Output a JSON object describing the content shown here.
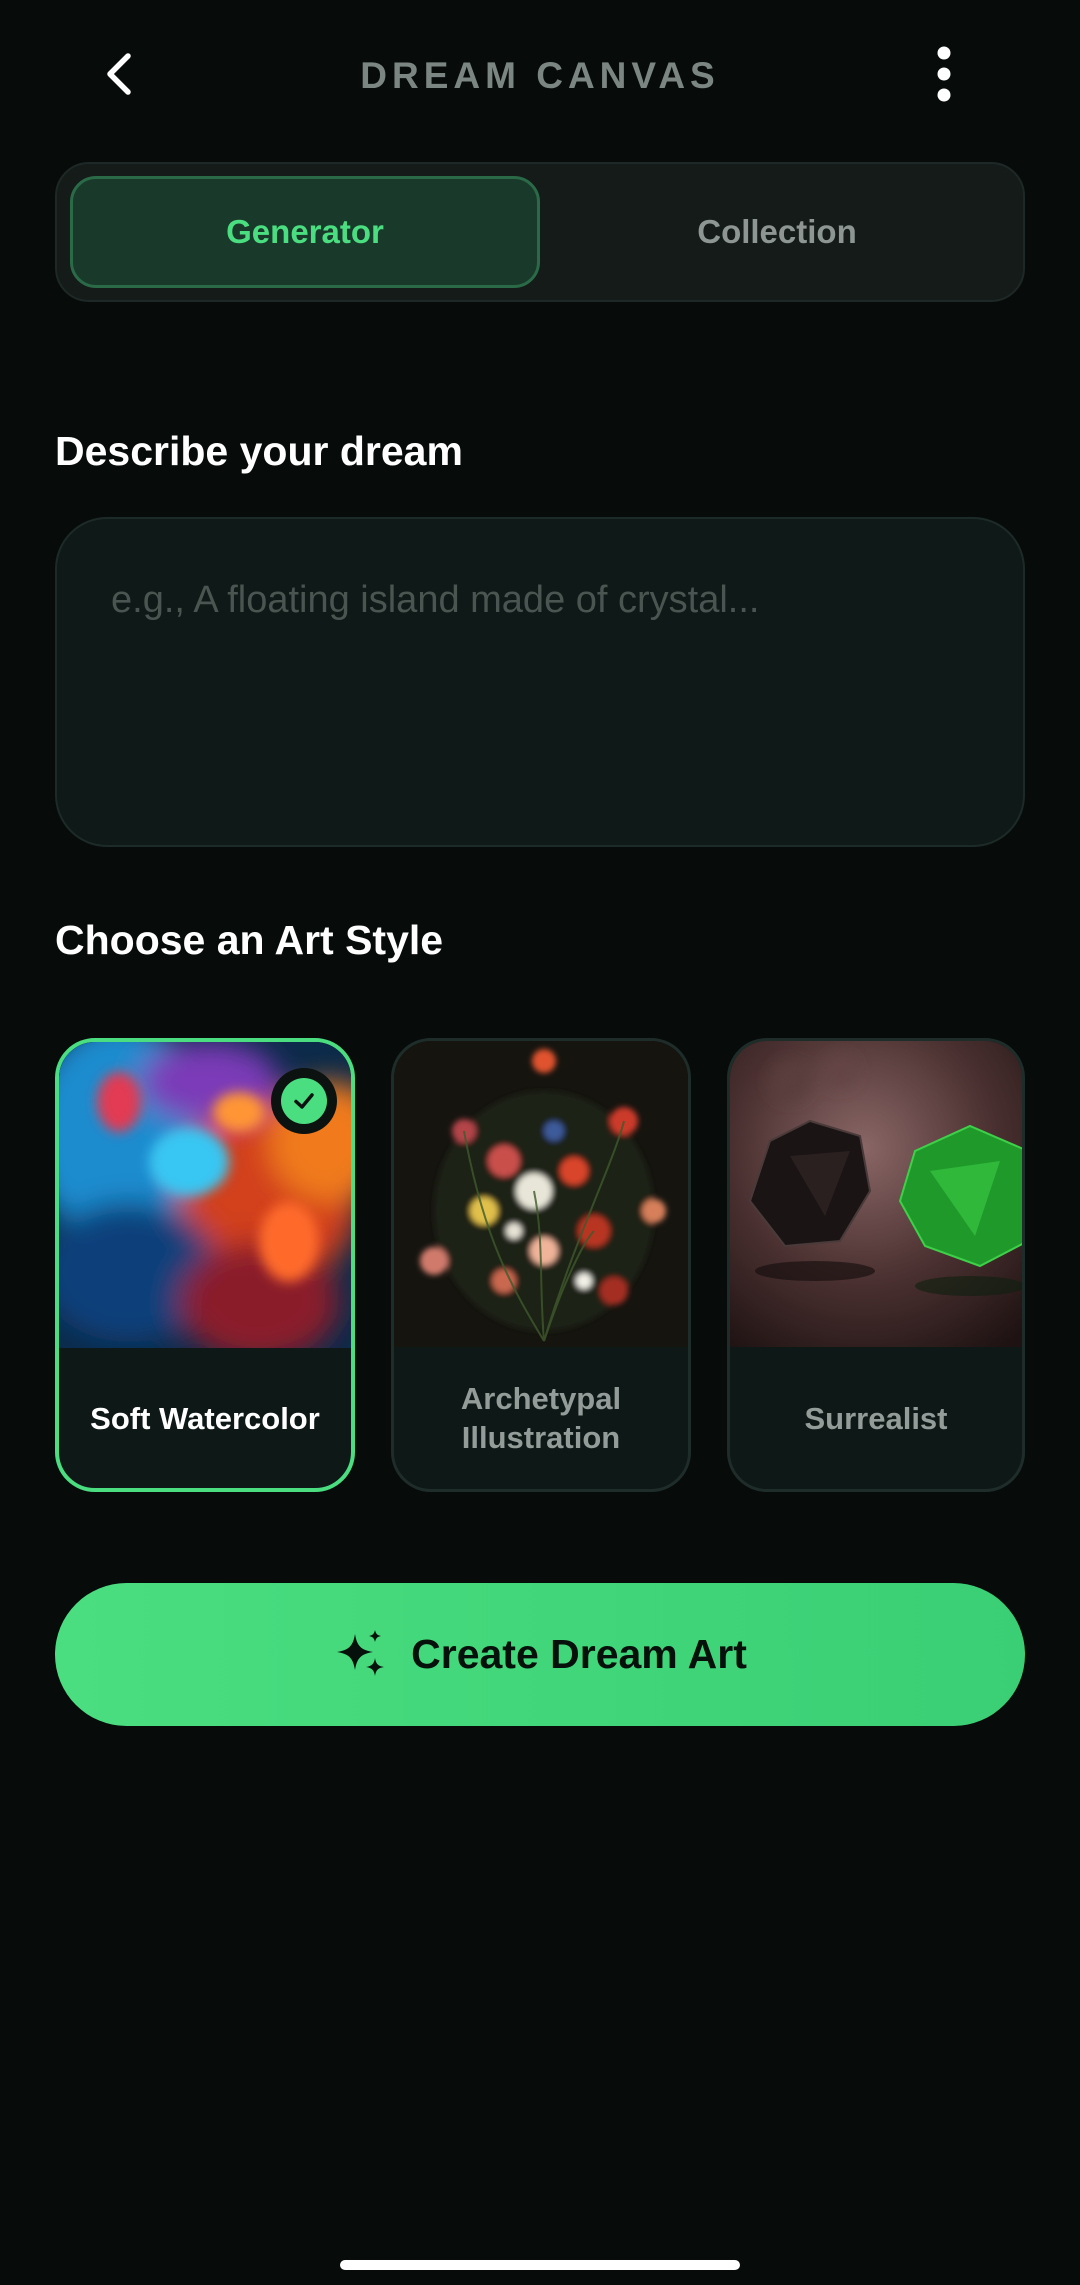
{
  "header": {
    "title": "DREAM CANVAS",
    "back_icon": "chevron-left-icon",
    "more_icon": "more-vertical-icon"
  },
  "tabs": [
    {
      "label": "Generator",
      "active": true
    },
    {
      "label": "Collection",
      "active": false
    }
  ],
  "prompt": {
    "label": "Describe your dream",
    "placeholder": "e.g., A floating island made of crystal...",
    "value": ""
  },
  "styles": {
    "label": "Choose an Art Style",
    "items": [
      {
        "label": "Soft Watercolor",
        "selected": true
      },
      {
        "label": "Archetypal Illustration",
        "selected": false
      },
      {
        "label": "Surrealist",
        "selected": false
      }
    ]
  },
  "create_button": {
    "label": "Create Dream Art",
    "icon": "sparkles-icon"
  },
  "colors": {
    "accent": "#4ade80",
    "background": "#070c0b",
    "surface": "#0f1917"
  }
}
